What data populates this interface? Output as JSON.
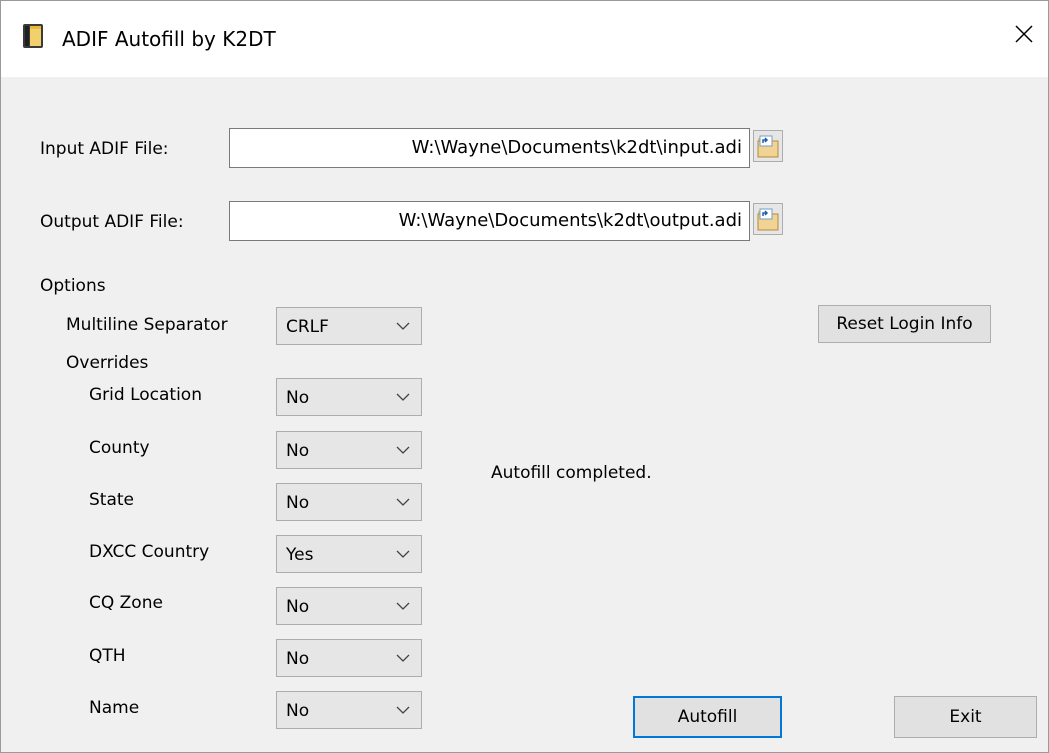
{
  "window": {
    "title": "ADIF Autofill by K2DT"
  },
  "files": {
    "input_label": "Input ADIF File:",
    "input_value": "W:\\Wayne\\Documents\\k2dt\\input.adi",
    "output_label": "Output ADIF File:",
    "output_value": "W:\\Wayne\\Documents\\k2dt\\output.adi"
  },
  "options": {
    "heading": "Options",
    "multiline_label": "Multiline Separator",
    "multiline_value": "CRLF",
    "overrides_heading": "Overrides",
    "overrides": [
      {
        "label": "Grid Location",
        "value": "No"
      },
      {
        "label": "County",
        "value": "No"
      },
      {
        "label": "State",
        "value": "No"
      },
      {
        "label": "DXCC Country",
        "value": "Yes"
      },
      {
        "label": "CQ Zone",
        "value": "No"
      },
      {
        "label": "QTH",
        "value": "No"
      },
      {
        "label": "Name",
        "value": "No"
      }
    ]
  },
  "status": {
    "text": "Autofill completed."
  },
  "buttons": {
    "reset_login": "Reset Login Info",
    "autofill": "Autofill",
    "exit": "Exit"
  },
  "colors": {
    "focus_border": "#0078d7",
    "button_face": "#e1e1e1",
    "window_bg": "#f0f0f0"
  }
}
